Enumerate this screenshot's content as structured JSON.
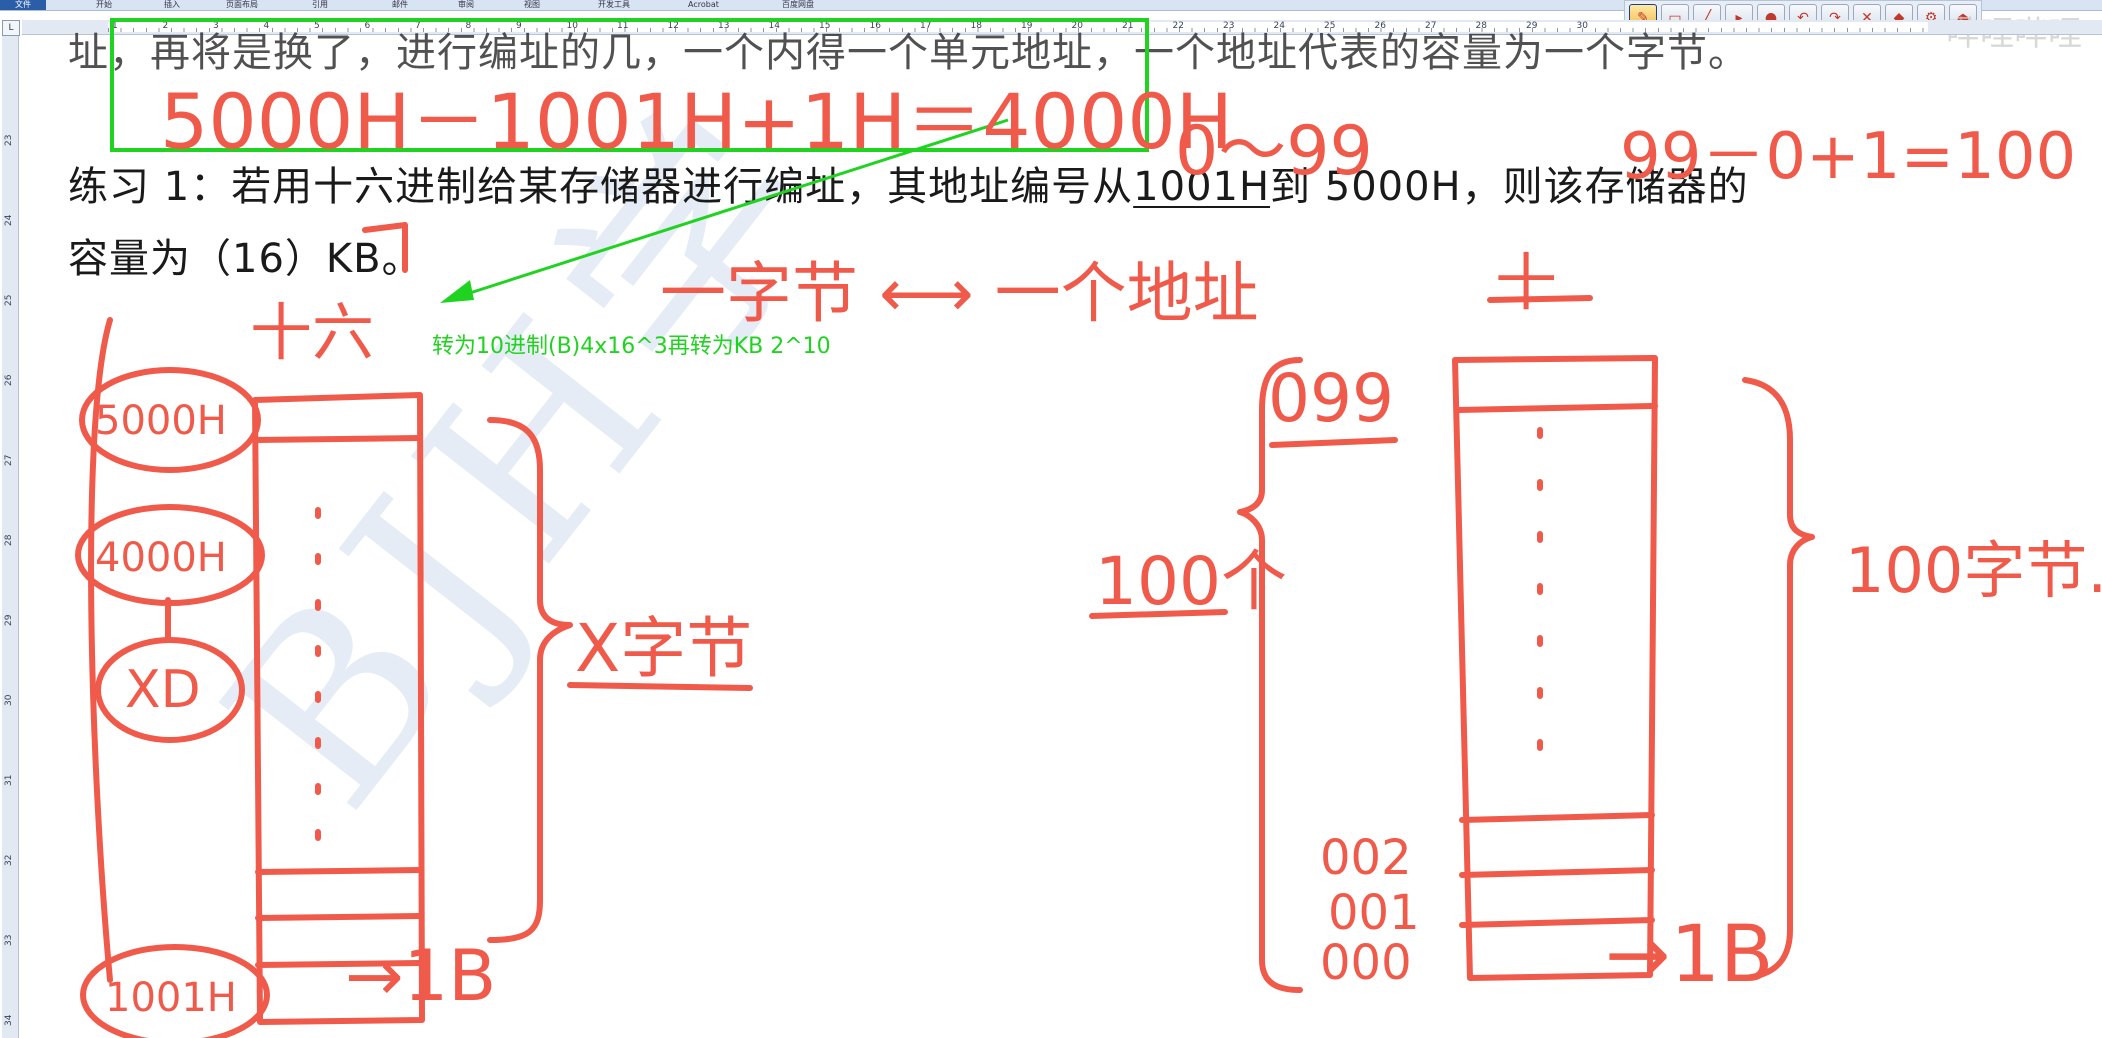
{
  "ribbon": {
    "file_tab": "文件",
    "menu": [
      "开始",
      "插入",
      "页面布局",
      "引用",
      "邮件",
      "审阅",
      "视图",
      "开发工具",
      "Acrobat",
      "百度网盘"
    ]
  },
  "ruler": {
    "corner": "L",
    "h_numbers": [
      "1",
      "2",
      "3",
      "4",
      "5",
      "6",
      "7",
      "8",
      "9",
      "10",
      "11",
      "12",
      "13",
      "14",
      "15",
      "16",
      "17",
      "18",
      "19",
      "20",
      "21",
      "22",
      "23",
      "24",
      "25",
      "26",
      "27",
      "28",
      "29",
      "30"
    ],
    "v_numbers": [
      "23",
      "24",
      "25",
      "26",
      "27",
      "28",
      "29",
      "30",
      "31",
      "32",
      "33",
      "34"
    ]
  },
  "document": {
    "line0_fragment": "址，再将是换了，进行编址的几，一个内得一个单元地址，一个地址代表的容量为一个字节。",
    "line1_a": "练习 1：若用十六进制给某存储器进行编址，其地址编号从",
    "line1_u": "1001H",
    "line1_b": "到 5000H，则该存储器的",
    "line2": "容量为（16）KB。"
  },
  "annotations": {
    "green_note": "转为10进制(B)4x16^3再转为KB 2^10",
    "green_box_formula": "5000H－1001H+1H＝4000H",
    "range": "0～99",
    "count": "99－0+1=100",
    "byte_address": "一字节 ⟷ 一个地址",
    "hex_label": "十六",
    "dec_label": "十",
    "left_top": "5000H",
    "left_mid": "4000H",
    "left_xd": "XD",
    "left_bottom": "1001H",
    "left_bytes": "X字节",
    "left_1b": "→1B",
    "right_top": "099",
    "right_100": "100个",
    "right_bytes": "100字节.",
    "right_002": "002",
    "right_001": "001",
    "right_000": "000",
    "right_1b": "→1B"
  },
  "toolbar_icons": [
    "pen-tool-icon",
    "eraser-icon",
    "highlighter-icon",
    "pointer-icon",
    "red-pen-icon",
    "undo-icon",
    "redo-icon",
    "clear-icon",
    "color-icon",
    "settings-icon",
    "exit-icon"
  ],
  "watermark": "BJH学",
  "brand": "哔哩哔哩",
  "colors": {
    "ink_red": "#ef5a4a",
    "green": "#21d321",
    "ribbon": "#2a5ea8"
  }
}
